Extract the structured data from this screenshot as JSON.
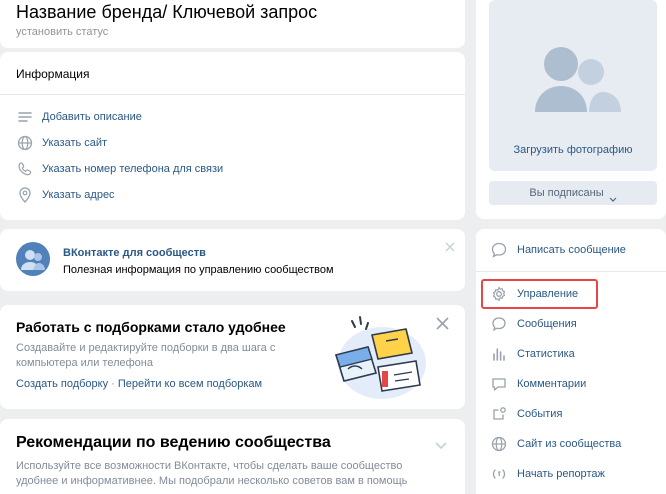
{
  "header": {
    "title": "Название бренда/ Ключевой запрос",
    "status_placeholder": "установить статус"
  },
  "info": {
    "heading": "Информация",
    "items": [
      {
        "icon": "lines-icon",
        "label": "Добавить описание"
      },
      {
        "icon": "globe-icon",
        "label": "Указать сайт"
      },
      {
        "icon": "phone-icon",
        "label": "Указать номер телефона для связи"
      },
      {
        "icon": "location-icon",
        "label": "Указать адрес"
      }
    ]
  },
  "vk_tip": {
    "title": "ВКонтакте для сообществ",
    "text": "Полезная информация по управлению сообществом"
  },
  "promo": {
    "title": "Работать с подборками стало удобнее",
    "text": "Создавайте и редактируйте подборки в два шага с компьютера или телефона",
    "link_create": "Создать подборку",
    "separator": " · ",
    "link_all": "Перейти ко всем подборкам"
  },
  "recommend": {
    "title": "Рекомендации по ведению сообщества",
    "text": "Используйте все возможности ВКонтакте, чтобы сделать ваше сообщество удобнее и информативнее. Мы подобрали несколько советов вам в помощь"
  },
  "photo": {
    "upload_label": "Загрузить фотографию",
    "subscribed_label": "Вы подписаны"
  },
  "menu": {
    "items": [
      {
        "icon": "message-icon",
        "label": "Написать сообщение"
      },
      {
        "icon": "gear-icon",
        "label": "Управление"
      },
      {
        "icon": "chat-icon",
        "label": "Сообщения"
      },
      {
        "icon": "stats-icon",
        "label": "Статистика"
      },
      {
        "icon": "comment-icon",
        "label": "Комментарии"
      },
      {
        "icon": "events-icon",
        "label": "События"
      },
      {
        "icon": "globe-icon",
        "label": "Сайт из сообщества"
      },
      {
        "icon": "broadcast-icon",
        "label": "Начать репортаж"
      }
    ]
  },
  "colors": {
    "background": "#edeef0",
    "link": "#2a5885",
    "highlight": "#e64646",
    "icon": "#99a2ad"
  }
}
